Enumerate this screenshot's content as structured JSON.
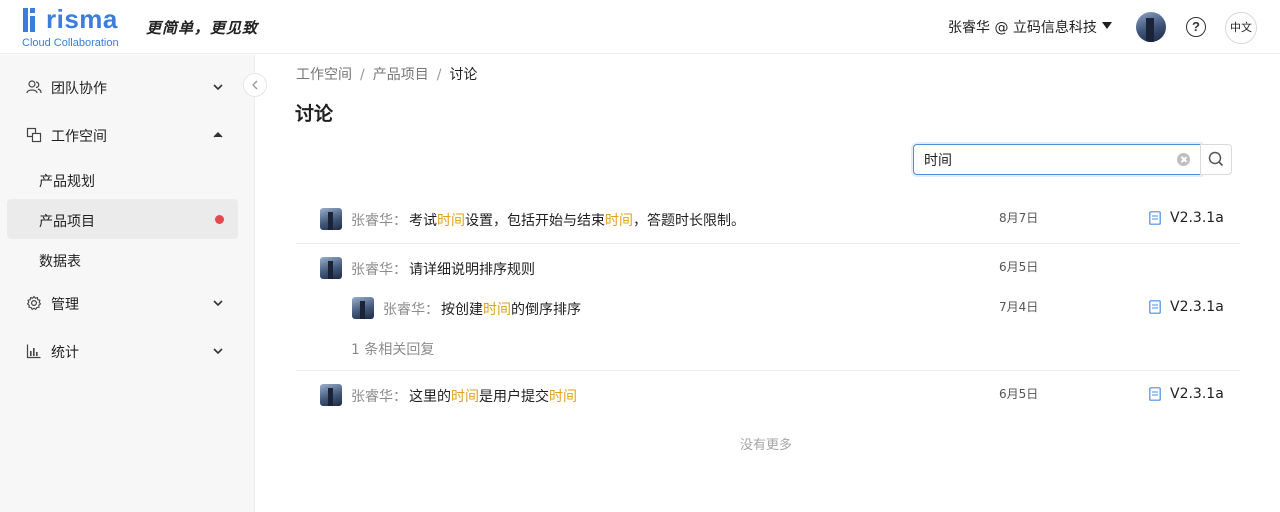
{
  "header": {
    "logo_text": "risma",
    "logo_subtitle": "Cloud Collaboration",
    "slogan": "更简单，更见致",
    "user_org": "张睿华 @ 立码信息科技",
    "lang_label": "中文"
  },
  "sidebar": {
    "groups": [
      {
        "label": "团队协作",
        "expanded": false,
        "icon": "team-icon"
      },
      {
        "label": "工作空间",
        "expanded": true,
        "icon": "workspace-icon"
      },
      {
        "label": "管理",
        "expanded": false,
        "icon": "gear-icon"
      },
      {
        "label": "统计",
        "expanded": false,
        "icon": "chart-icon"
      }
    ],
    "sub_items": [
      {
        "label": "产品规划",
        "active": false
      },
      {
        "label": "产品项目",
        "active": true,
        "dot": true
      },
      {
        "label": "数据表",
        "active": false
      }
    ]
  },
  "breadcrumb": {
    "items": [
      "工作空间",
      "产品项目",
      "讨论"
    ],
    "separator": "/"
  },
  "page_title": "讨论",
  "search": {
    "value": "时间"
  },
  "comments": [
    {
      "author": "张睿华：",
      "segments": [
        "考试",
        "时间",
        "设置，包括开始与结束",
        "时间",
        "，答题时长限制。"
      ],
      "date": "8月7日",
      "version": "V2.3.1a"
    },
    {
      "author": "张睿华：",
      "segments": [
        "请详细说明排序规则"
      ],
      "date": "6月5日",
      "reply": {
        "author": "张睿华：",
        "segments": [
          "按创建",
          "时间",
          "的倒序排序"
        ],
        "date": "7月4日",
        "version": "V2.3.1a"
      },
      "reply_count_text": "1 条相关回复"
    },
    {
      "author": "张睿华：",
      "segments": [
        "这里的",
        "时间",
        "是用户提交",
        "时间"
      ],
      "date": "6月5日",
      "version": "V2.3.1a"
    }
  ],
  "no_more_text": "没有更多",
  "colors": {
    "brand": "#3b7ddd",
    "highlight": "#e0a11b",
    "active_dot": "#e5484d",
    "focus_border": "#4a8fe0"
  }
}
